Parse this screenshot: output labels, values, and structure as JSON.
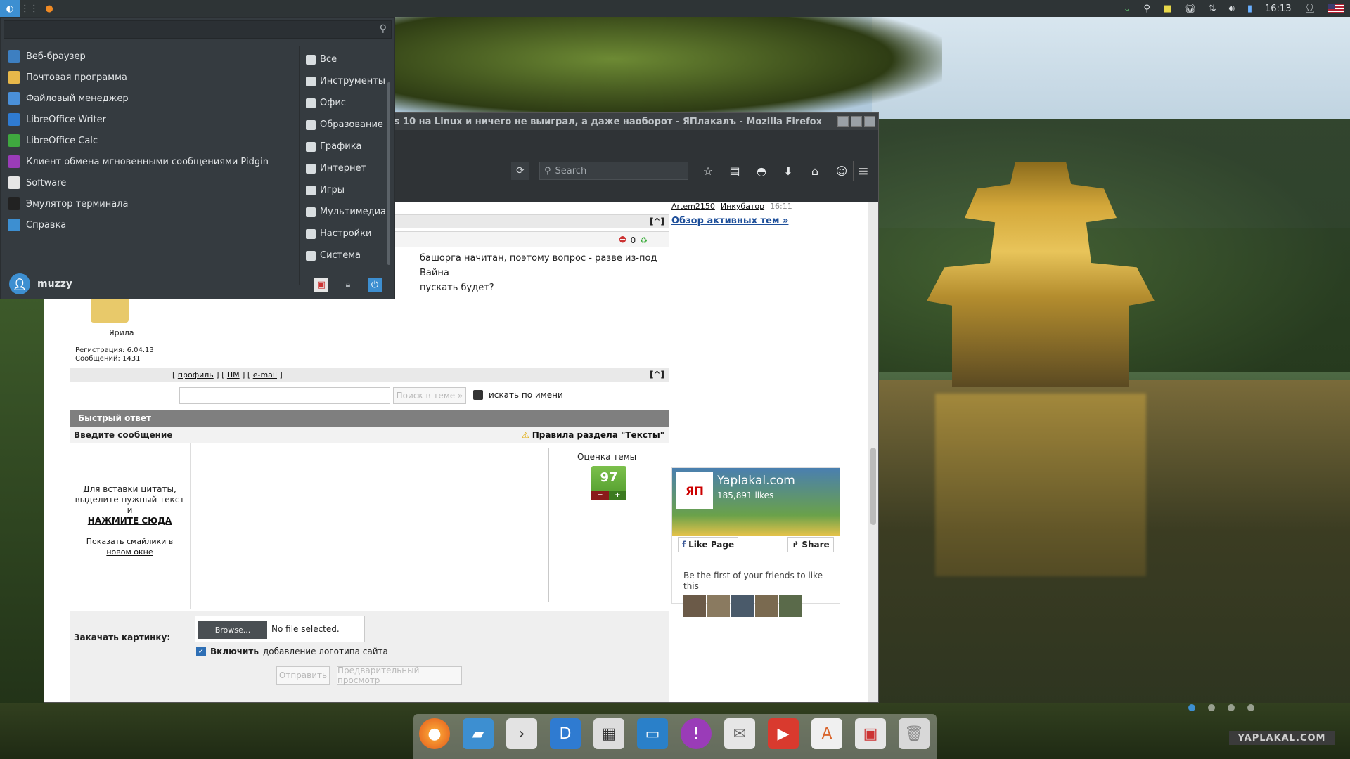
{
  "panel": {
    "clock": "16:13"
  },
  "firefox": {
    "window_title": "я заменил Windows 10 на Linux и ничего не выиграл, а даже наоборот - ЯПлакалъ - Mozilla Firefox",
    "search_placeholder": "Search"
  },
  "forum": {
    "top_user_line": "Artem2150",
    "top_user_line2": "Инкубатор",
    "top_time": "16:11",
    "overview_link": "Обзор активных тем »",
    "post_text_1": "башорга начитан, поэтому вопрос - разве из-под Вайна",
    "post_text_2": "пускать будет?",
    "vote_count": "0",
    "author_name": "Ярила",
    "author_reg": "Регистрация:  6.04.13",
    "author_posts": "Сообщений:  1431",
    "links_profile": "профиль",
    "links_pm": "ПМ",
    "links_email": "e-mail",
    "jump_top": "[^]",
    "search_in_topic_btn": "Поиск в теме »",
    "search_by_name_label": "искать по имени",
    "quick_reply_header": "Быстрый ответ",
    "enter_message_label": "Введите сообщение",
    "rules_link": "Правила раздела \"Тексты\"",
    "quote_hint_1": "Для вставки цитаты,",
    "quote_hint_2": "выделите нужный текст",
    "quote_hint_3": "и",
    "quote_hint_click": "НАЖМИТЕ СЮДА",
    "smileys_link_1": "Показать смайлики в",
    "smileys_link_2": "новом окне",
    "rating_label": "Оценка темы",
    "rating_value": "97",
    "upload_label": "Закачать картинку:",
    "browse_btn": "Browse...",
    "no_file": "No file selected.",
    "logo_checkbox_bold": "Включить",
    "logo_checkbox_rest": "добавление логотипа сайта",
    "submit_btn": "Отправить",
    "preview_btn": "Предварительный просмотр"
  },
  "fb_widget": {
    "site": "Yaplakal.com",
    "likes": "185,891 likes",
    "like_page": "Like Page",
    "share": "Share",
    "friends_text": "Be the first of your friends to like this"
  },
  "app_menu": {
    "apps": [
      {
        "label": "Веб-браузер",
        "icon": "web-browser-icon",
        "color": "#3d7fc1"
      },
      {
        "label": "Почтовая программа",
        "icon": "mail-icon",
        "color": "#e8b84a"
      },
      {
        "label": "Файловый менеджер",
        "icon": "file-manager-icon",
        "color": "#4a90d9"
      },
      {
        "label": "LibreOffice Writer",
        "icon": "writer-icon",
        "color": "#2f7bd1"
      },
      {
        "label": "LibreOffice Calc",
        "icon": "calc-icon",
        "color": "#3fa83f"
      },
      {
        "label": "Клиент обмена мгновенными сообщениями Pidgin",
        "icon": "pidgin-icon",
        "color": "#9a3cb8"
      },
      {
        "label": "Software",
        "icon": "software-icon",
        "color": "#e6e6e6"
      },
      {
        "label": "Эмулятор терминала",
        "icon": "terminal-icon",
        "color": "#222"
      },
      {
        "label": "Справка",
        "icon": "help-icon",
        "color": "#3d8fd1"
      }
    ],
    "categories": [
      "Все",
      "Инструменты",
      "Офис",
      "Образование",
      "Графика",
      "Интернет",
      "Игры",
      "Мультимедиа",
      "Настройки",
      "Система"
    ],
    "username": "muzzy"
  },
  "watermark": "YAPLAKAL.COM"
}
